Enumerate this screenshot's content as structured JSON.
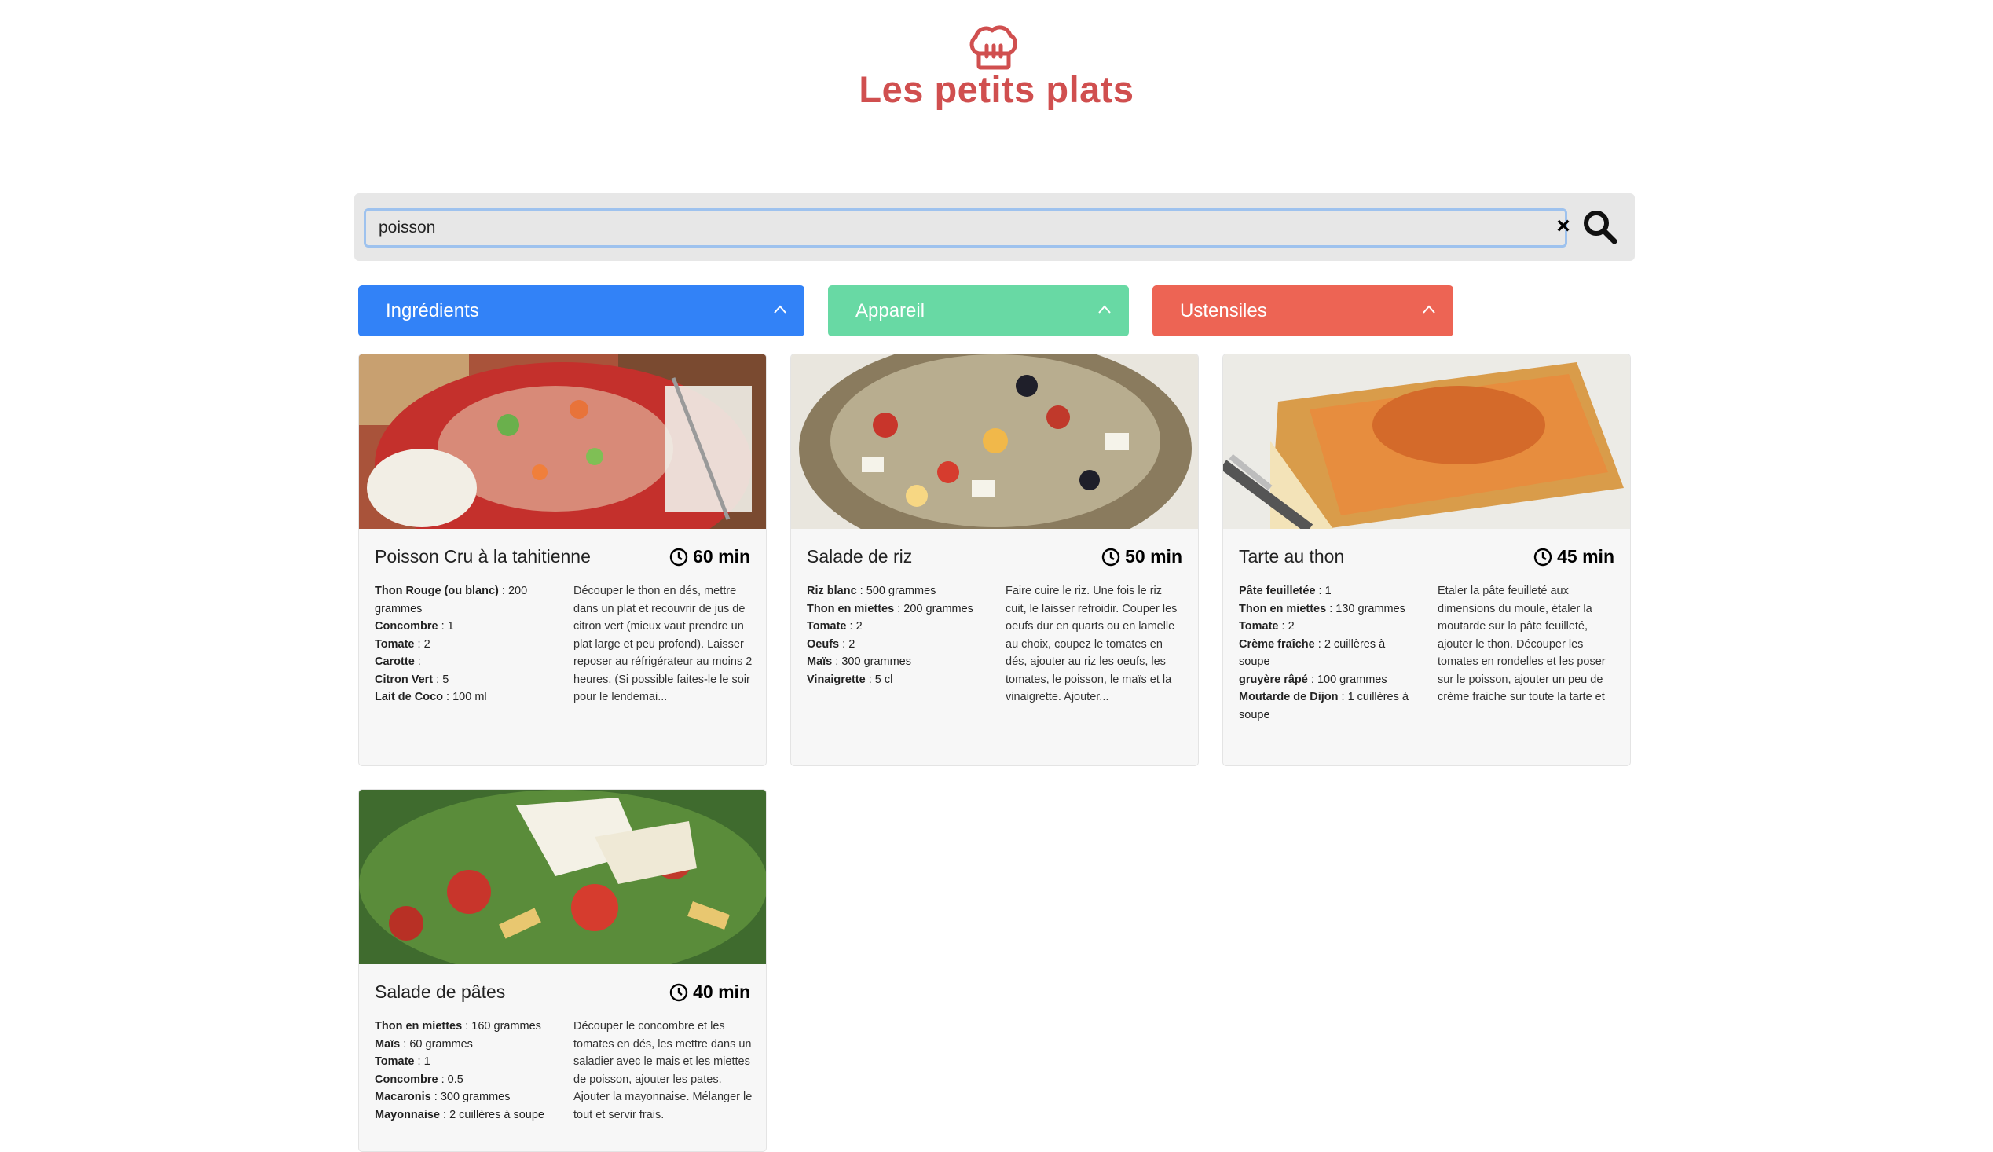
{
  "header": {
    "title": "Les petits plats"
  },
  "search": {
    "value": "poisson",
    "clear_label": "×"
  },
  "filters": [
    {
      "label": "Ingrédients",
      "color": "#3282f7"
    },
    {
      "label": "Appareil",
      "color": "#68d9a4"
    },
    {
      "label": "Ustensiles",
      "color": "#ed6454"
    }
  ],
  "recipes": [
    {
      "title": "Poisson Cru à la tahitienne",
      "time": "60 min",
      "ingredients": [
        {
          "name": "Thon Rouge (ou blanc)",
          "qty": "200 grammes"
        },
        {
          "name": "Concombre",
          "qty": "1"
        },
        {
          "name": "Tomate",
          "qty": "2"
        },
        {
          "name": "Carotte",
          "qty": ""
        },
        {
          "name": "Citron Vert",
          "qty": "5"
        },
        {
          "name": "Lait de Coco",
          "qty": "100 ml"
        }
      ],
      "description": "Découper le thon en dés, mettre dans un plat et recouvrir de jus de citron vert (mieux vaut prendre un plat large et peu profond). Laisser reposer au réfrigérateur au moins 2 heures. (Si possible faites-le le soir pour le lendemai..."
    },
    {
      "title": "Salade de riz",
      "time": "50 min",
      "ingredients": [
        {
          "name": "Riz blanc",
          "qty": "500 grammes"
        },
        {
          "name": "Thon en miettes",
          "qty": "200 grammes"
        },
        {
          "name": "Tomate",
          "qty": "2"
        },
        {
          "name": "Oeufs",
          "qty": "2"
        },
        {
          "name": "Maïs",
          "qty": "300 grammes"
        },
        {
          "name": "Vinaigrette",
          "qty": "5 cl"
        }
      ],
      "description": "Faire cuire le riz. Une fois le riz cuit, le laisser refroidir. Couper les oeufs dur en quarts ou en lamelle au choix, coupez le tomates en dés, ajouter au riz les oeufs, les tomates, le poisson, le maïs et la vinaigrette. Ajouter..."
    },
    {
      "title": "Tarte au thon",
      "time": "45 min",
      "ingredients": [
        {
          "name": "Pâte feuilletée",
          "qty": "1"
        },
        {
          "name": "Thon en miettes",
          "qty": "130 grammes"
        },
        {
          "name": "Tomate",
          "qty": "2"
        },
        {
          "name": "Crème fraîche",
          "qty": "2 cuillères à soupe"
        },
        {
          "name": "gruyère râpé",
          "qty": "100 grammes"
        },
        {
          "name": "Moutarde de Dijon",
          "qty": "1 cuillères à soupe"
        }
      ],
      "description": "Etaler la pâte feuilleté aux dimensions du moule, étaler la moutarde sur la pâte feuilleté, ajouter le thon. Découper les tomates en rondelles et les poser sur le poisson, ajouter un peu de crème fraiche sur toute la tarte et reco..."
    },
    {
      "title": "Salade de pâtes",
      "time": "40 min",
      "ingredients": [
        {
          "name": "Thon en miettes",
          "qty": "160 grammes"
        },
        {
          "name": "Maïs",
          "qty": "60 grammes"
        },
        {
          "name": "Tomate",
          "qty": "1"
        },
        {
          "name": "Concombre",
          "qty": "0.5"
        },
        {
          "name": "Macaronis",
          "qty": "300 grammes"
        },
        {
          "name": "Mayonnaise",
          "qty": "2 cuillères à soupe"
        }
      ],
      "description": "Découper le concombre et les tomates en dés, les mettre dans un saladier avec le mais et les miettes de poisson, ajouter les pates. Ajouter la mayonnaise. Mélanger le tout et servir frais."
    }
  ]
}
